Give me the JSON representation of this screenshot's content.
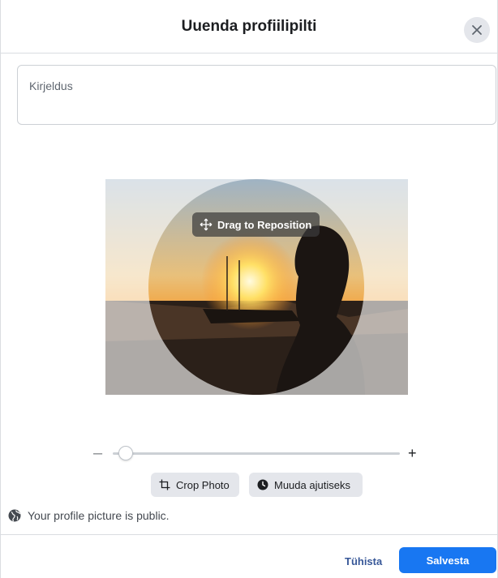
{
  "dialog": {
    "title": "Uuenda profiilipilti",
    "close_icon": "close-icon"
  },
  "description": {
    "placeholder": "Kirjeldus"
  },
  "photo": {
    "drag_label": "Drag to Reposition",
    "drag_icon": "move-arrows-icon"
  },
  "zoom": {
    "minus_label": "–",
    "plus_label": "+",
    "level": 0.02
  },
  "actions": {
    "crop_label": "Crop Photo",
    "crop_icon": "crop-icon",
    "temp_label": "Muuda ajutiseks",
    "temp_icon": "clock-icon"
  },
  "privacy": {
    "text": "Your profile picture is public.",
    "icon": "globe-icon"
  },
  "footer": {
    "cancel_label": "Tühista",
    "save_label": "Salvesta"
  },
  "colors": {
    "primary": "#1877f2",
    "link": "#385898"
  }
}
